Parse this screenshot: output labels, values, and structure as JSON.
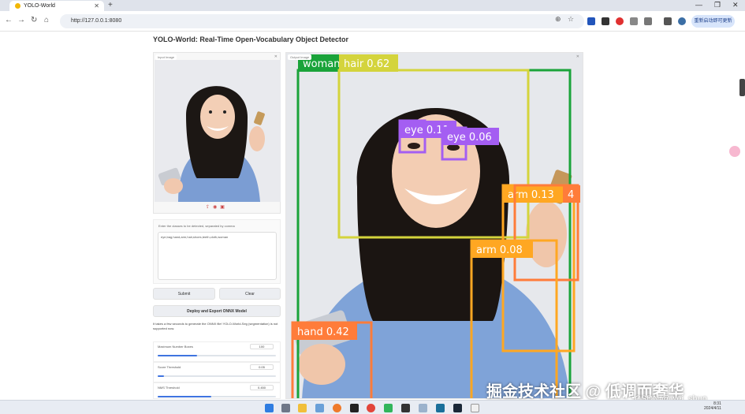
{
  "browser": {
    "tab_title": "YOLO-World",
    "url": "http://127.0.0.1:8080",
    "update_button": "重新启动即可更新"
  },
  "page": {
    "title": "YOLO-World: Real-Time Open-Vocabulary Object Detector"
  },
  "input_image": {
    "label": "Input Image"
  },
  "classes": {
    "label": "Enter the classes to be detected, separated by comma",
    "value": "eye,bag,hand,arm,hair,shoes,teeth,cloth,woman"
  },
  "buttons": {
    "submit": "Submit",
    "clear": "Clear",
    "deploy": "Deploy and Export ONNX Model"
  },
  "note": "It takes a few seconds to generate the ONNX file! YOLO-World-Seg (segmentation) is not supported now.",
  "sliders": [
    {
      "label": "Maximum Number Boxes",
      "value": "100",
      "fraction": 0.33
    },
    {
      "label": "Score Threshold",
      "value": "0.05",
      "fraction": 0.05
    },
    {
      "label": "NMS Threshold",
      "value": "0.450",
      "fraction": 0.45
    }
  ],
  "output_image": {
    "label": "Output Image",
    "detections": [
      {
        "text": "woman",
        "color": "#1aa33a"
      },
      {
        "text": "hair 0.62",
        "color": "#d4d43c"
      },
      {
        "text": "eye 0.11",
        "color": "#a45ef2"
      },
      {
        "text": "eye 0.06",
        "color": "#a45ef2"
      },
      {
        "text": "arm 0.13",
        "color": "#ffa722"
      },
      {
        "text": "4",
        "color": "#ff7c3a"
      },
      {
        "text": "arm 0.08",
        "color": "#ffa722"
      },
      {
        "text": "hand 0.42",
        "color": "#ff7c3a"
      }
    ]
  },
  "watermark": {
    "main": "掘金技术社区 @ 低调而奢华",
    "csdn": "CSDN @wei_shuo"
  },
  "clock": {
    "time": "8:31",
    "date": "2024/4/11"
  }
}
